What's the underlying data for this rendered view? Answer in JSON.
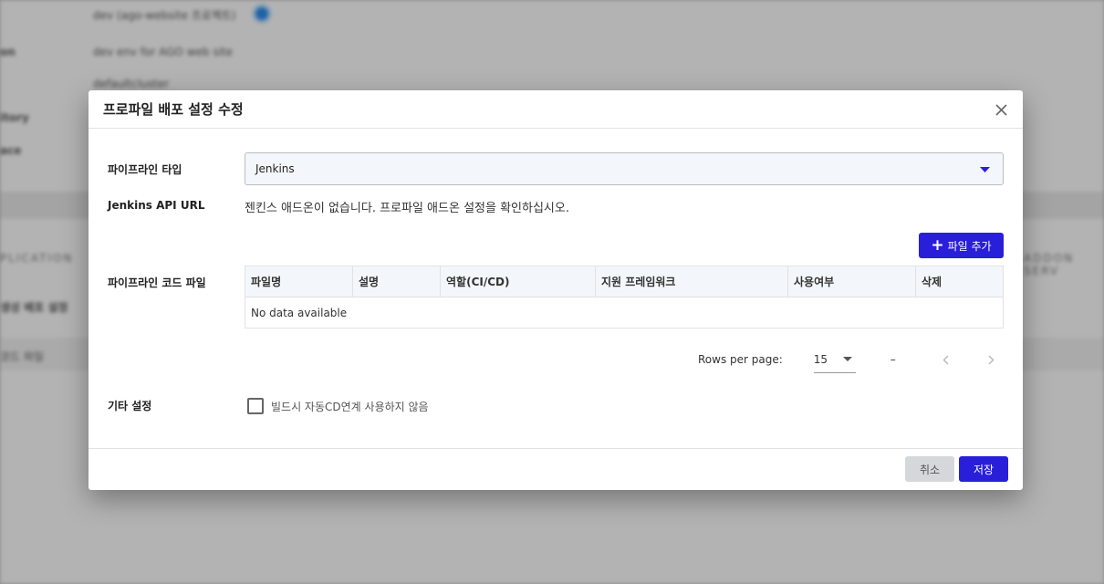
{
  "background": {
    "line1": "dev (ago-website 프로젝트)",
    "line2": "dev env for AGO web site",
    "line3": "defaultcluster",
    "left_labels": [
      "on",
      "itory",
      "ace"
    ],
    "tab_left": "PLICATION",
    "tab_right": "ADDON SERV",
    "section_left": "생성 배포 설정",
    "row_left": "코드 파일"
  },
  "modal": {
    "title": "프로파일 배포 설정 수정",
    "pipeline_type_label": "파이프라인 타입",
    "pipeline_type_value": "Jenkins",
    "api_url_label": "Jenkins API URL",
    "api_url_text": "젠킨스 애드온이 없습니다. 프로파일 애드온 설정을 확인하십시오.",
    "add_file_label": "파일 추가",
    "code_file_label": "파이프라인 코드 파일",
    "table": {
      "columns": [
        "파일명",
        "설명",
        "역할(CI/CD)",
        "지원 프레임워크",
        "사용여부",
        "삭제"
      ],
      "empty_text": "No data available"
    },
    "pagination": {
      "rows_per_page_label": "Rows per page:",
      "rows_per_page_value": "15",
      "range": "–"
    },
    "other_settings_label": "기타 설정",
    "checkbox_label": "빌드시 자동CD연계 사용하지 않음",
    "cancel_label": "취소",
    "save_label": "저장"
  },
  "colors": {
    "primary": "#2a1fd9",
    "cancel_bg": "#d5d7db",
    "header_bg": "#f3f6fa"
  },
  "icons": {
    "close": "close-icon",
    "dropdown": "caret-down-icon",
    "add": "plus-icon",
    "prev": "chevron-left-icon",
    "next": "chevron-right-icon"
  }
}
